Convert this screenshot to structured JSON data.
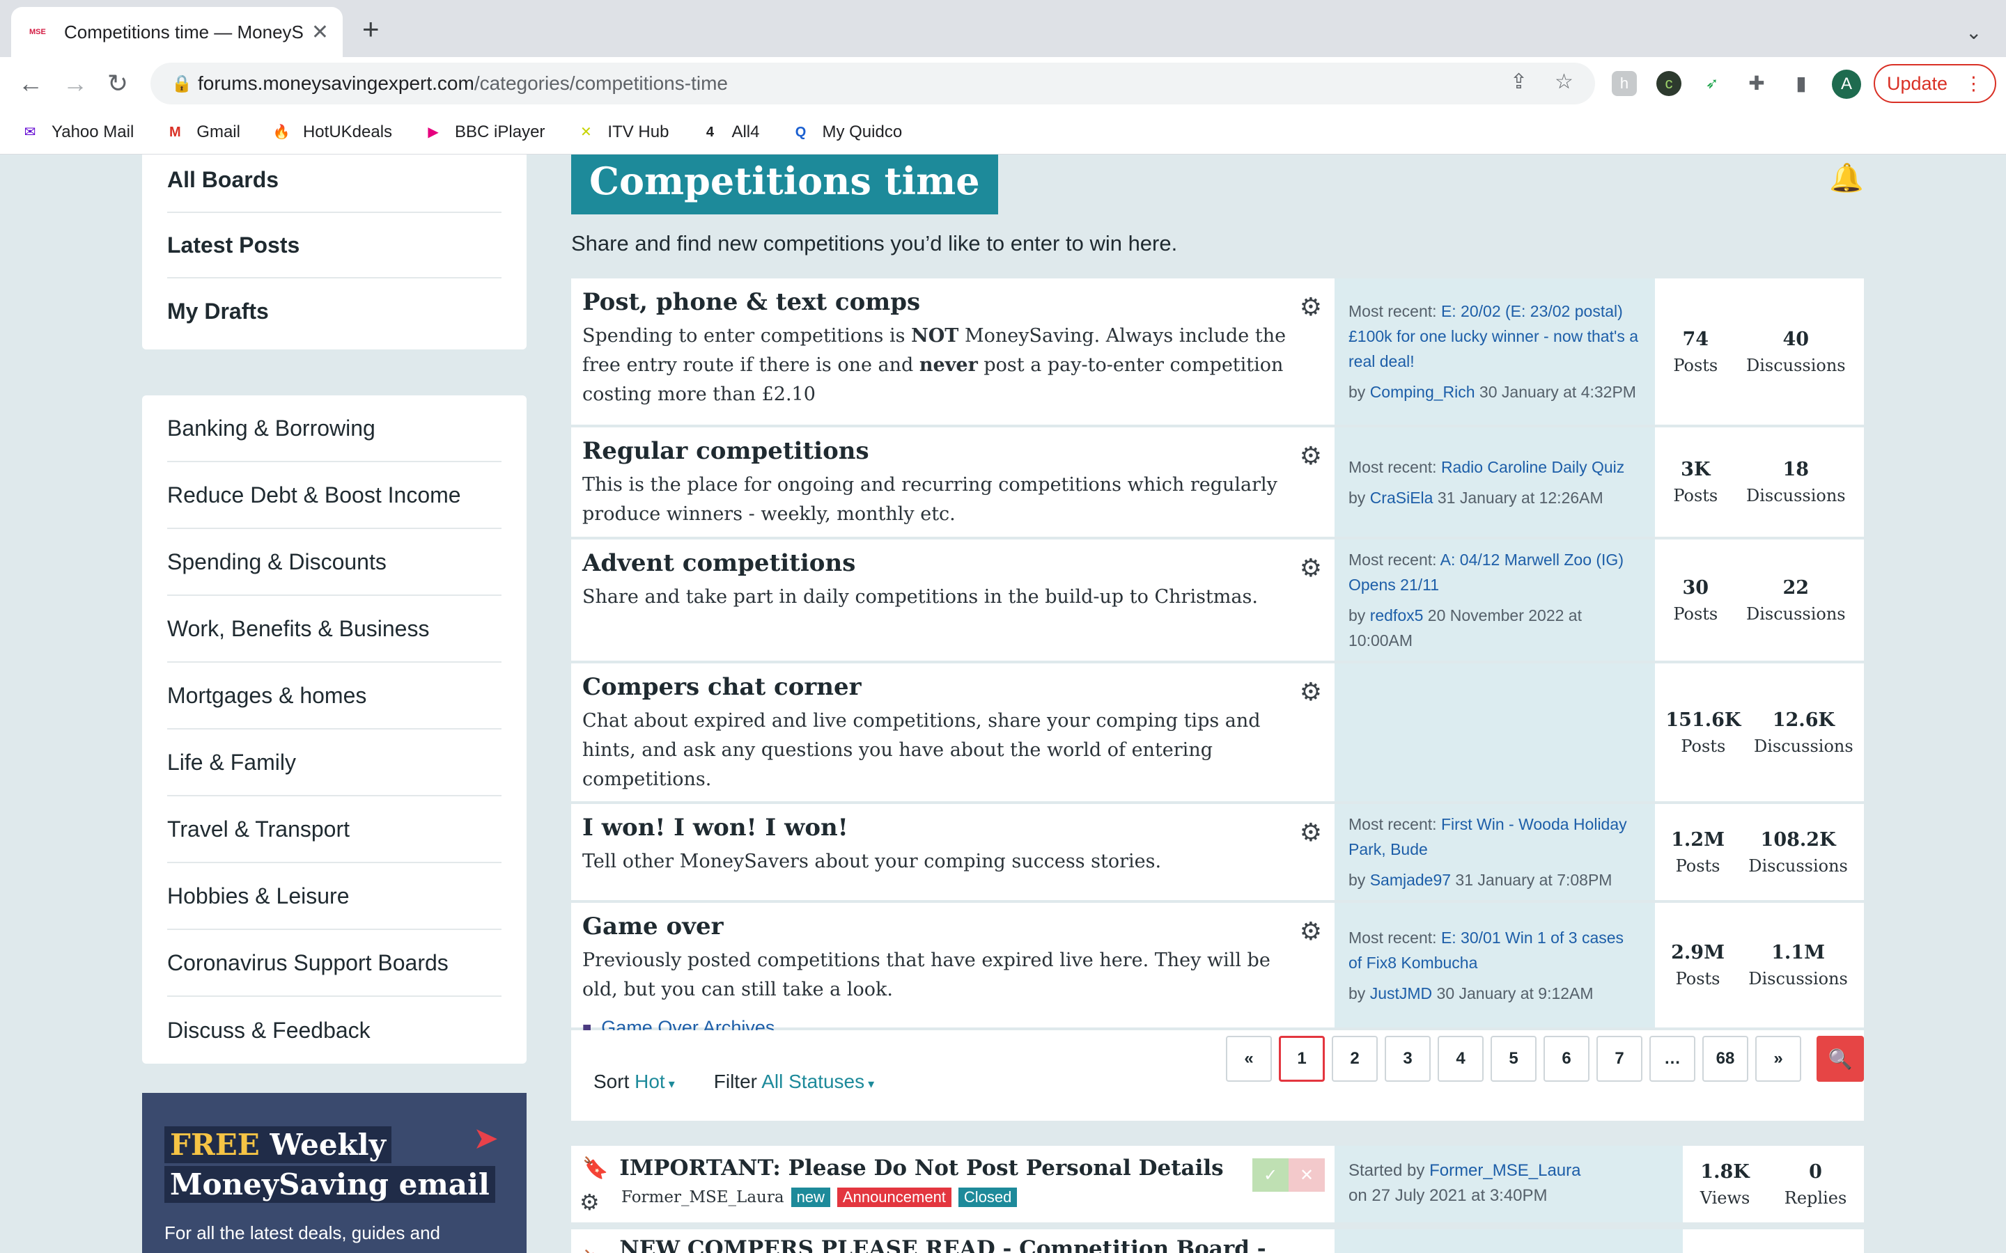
{
  "browser": {
    "tab_title": "Competitions time — MoneySa",
    "tab_favicon": "MSE",
    "url_host": "forums.moneysavingexpert.com",
    "url_path": "/categories/competitions-time",
    "update_label": "Update",
    "avatar_letter": "A",
    "bookmarks": [
      {
        "label": "Yahoo Mail",
        "icon": "yahoo-icon",
        "glyph": "✉",
        "color": "#5f01d1"
      },
      {
        "label": "Gmail",
        "icon": "gmail-icon",
        "glyph": "M",
        "color": "#d93025"
      },
      {
        "label": "HotUKdeals",
        "icon": "flame-icon",
        "glyph": "🔥",
        "color": "#f05a22"
      },
      {
        "label": "BBC iPlayer",
        "icon": "iplayer-icon",
        "glyph": "▶",
        "color": "#e6007e"
      },
      {
        "label": "ITV Hub",
        "icon": "itv-icon",
        "glyph": "✕",
        "color": "#c6d300"
      },
      {
        "label": "All4",
        "icon": "all4-icon",
        "glyph": "4",
        "color": "#202124"
      },
      {
        "label": "My Quidco",
        "icon": "quidco-icon",
        "glyph": "Q",
        "color": "#1a5fd0"
      }
    ]
  },
  "sidebar": {
    "top_items": [
      "All Boards",
      "Latest Posts",
      "My Drafts"
    ],
    "categories": [
      "Banking & Borrowing",
      "Reduce Debt & Boost Income",
      "Spending & Discounts",
      "Work, Benefits & Business",
      "Mortgages & homes",
      "Life & Family",
      "Travel & Transport",
      "Hobbies & Leisure",
      "Coronavirus Support Boards",
      "Discuss & Feedback"
    ],
    "promo": {
      "free": "FREE",
      "weekly": " Weekly",
      "line2": "MoneySaving email",
      "small": "For all the latest deals, guides and"
    }
  },
  "category": {
    "title": "Competitions time",
    "description": "Share and find new competitions you’d like to enter to win here."
  },
  "boards": [
    {
      "name": "Post, phone & text comps",
      "desc_parts": [
        "Spending to enter competitions is ",
        "NOT",
        " MoneySaving. Always include the free entry route if there is one and ",
        "never",
        " post a pay-to-enter competition costing more than £2.10"
      ],
      "recent_label": "Most recent: ",
      "recent_link": "E: 20/02 (E: 23/02 postal) £100k for one lucky winner - now that's a real deal!",
      "by": "by ",
      "author": "Comping_Rich",
      "when": " 30 January at 4:32PM",
      "posts": "74",
      "discussions": "40"
    },
    {
      "name": "Regular competitions",
      "desc": "This is the place for ongoing and recurring competitions which regularly produce winners - weekly, monthly etc.",
      "recent_label": "Most recent: ",
      "recent_link": "Radio Caroline Daily Quiz",
      "by": "by ",
      "author": "CraSiEla",
      "when": " 31 January at 12:26AM",
      "posts": "3K",
      "discussions": "18"
    },
    {
      "name": "Advent competitions",
      "desc": "Share and take part in daily competitions in the build-up to Christmas.",
      "recent_label": "Most recent: ",
      "recent_link": "A: 04/12 Marwell Zoo (IG) Opens 21/11",
      "by": "by ",
      "author": "redfox5",
      "when": " 20 November 2022 at 10:00AM",
      "posts": "30",
      "discussions": "22"
    },
    {
      "name": "Compers chat corner",
      "desc": "Chat about expired and live competitions, share your comping tips and hints, and ask any questions you have about the world of entering competitions.",
      "posts": "151.6K",
      "discussions": "12.6K"
    },
    {
      "name": "I won! I won! I won!",
      "desc": "Tell other MoneySavers about your comping success stories.",
      "recent_label": "Most recent: ",
      "recent_link": "First Win - Wooda Holiday Park, Bude",
      "by": "by ",
      "author": "Samjade97",
      "when": " 31 January at 7:08PM",
      "posts": "1.2M",
      "discussions": "108.2K"
    },
    {
      "name": "Game over",
      "desc": "Previously posted competitions that have expired live here. They will be old, but you can still take a look.",
      "sub_board": "Game Over Archives",
      "recent_label": "Most recent: ",
      "recent_link": "E: 30/01 Win 1 of 3 cases of Fix8 Kombucha",
      "by": "by ",
      "author": "JustJMD",
      "when": " 30 January at 9:12AM",
      "posts": "2.9M",
      "discussions": "1.1M"
    }
  ],
  "labels": {
    "posts": "Posts",
    "discussions": "Discussions",
    "views": "Views",
    "replies": "Replies"
  },
  "pagination": {
    "prev": "«",
    "next": "»",
    "ellipsis": "…",
    "pages": [
      "1",
      "2",
      "3",
      "4",
      "5",
      "6",
      "7"
    ],
    "last": "68",
    "current": "1"
  },
  "sort": {
    "label": "Sort",
    "value": "Hot",
    "filter_label": "Filter",
    "filter_value": "All Statuses"
  },
  "discussions": [
    {
      "title": "IMPORTANT: Please Do Not Post Personal Details",
      "author": "Former_MSE_Laura",
      "badges": [
        "new",
        "Announcement",
        "Closed"
      ],
      "started_label": "Started by ",
      "started_by": "Former_MSE_Laura",
      "started_on": "on 27 July 2021 at 3:40PM",
      "views": "1.8K",
      "replies": "0"
    },
    {
      "title": "NEW COMPERS PLEASE READ - Competition Board - useful links"
    }
  ]
}
